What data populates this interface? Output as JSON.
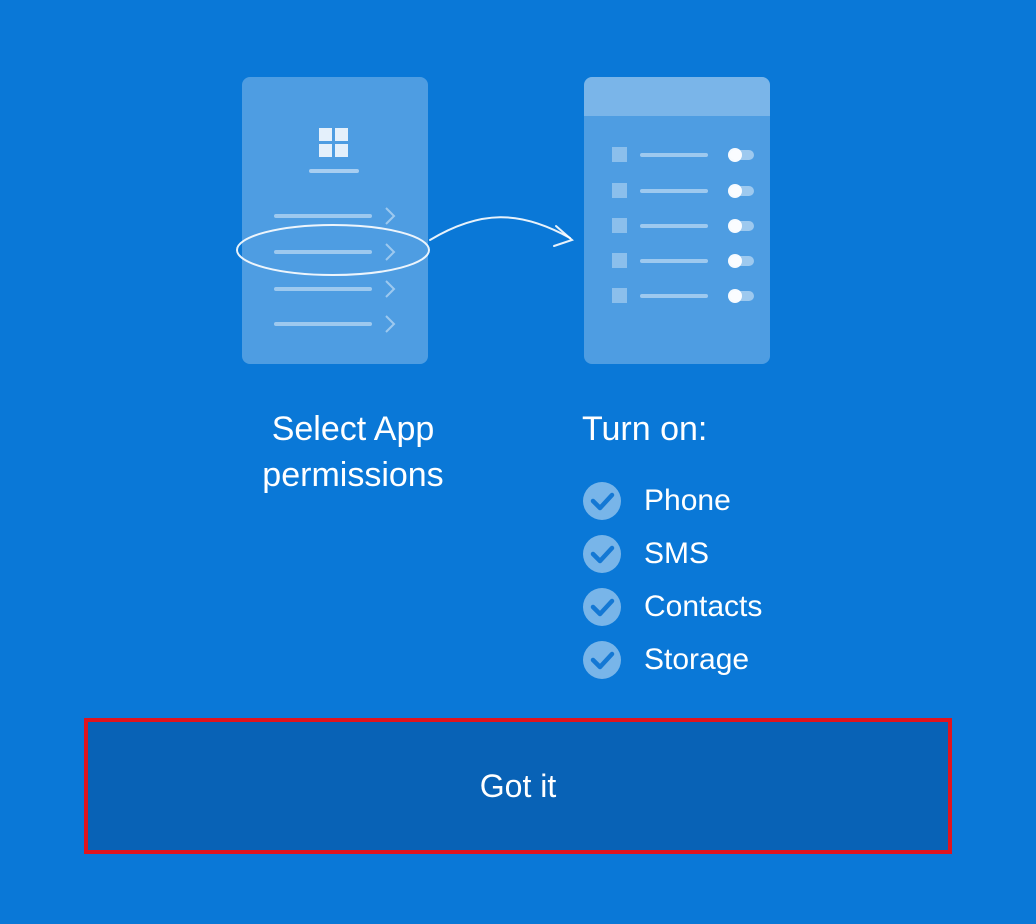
{
  "screen": {
    "background_color": "#0A78D7"
  },
  "illustration": {
    "left_panel_icon": "app-grid-icon",
    "arrow_icon": "curved-arrow-icon",
    "right_panel_icon": "toggle-list-icon"
  },
  "instructions": {
    "step1_line1": "Select App",
    "step1_line2": "permissions",
    "step2_title": "Turn on:",
    "permissions": [
      {
        "label": "Phone",
        "icon": "check-circle-icon"
      },
      {
        "label": "SMS",
        "icon": "check-circle-icon"
      },
      {
        "label": "Contacts",
        "icon": "check-circle-icon"
      },
      {
        "label": "Storage",
        "icon": "check-circle-icon"
      }
    ]
  },
  "action": {
    "button_label": "Got it",
    "button_color": "#0862B6",
    "highlight_color": "#E0141E"
  }
}
